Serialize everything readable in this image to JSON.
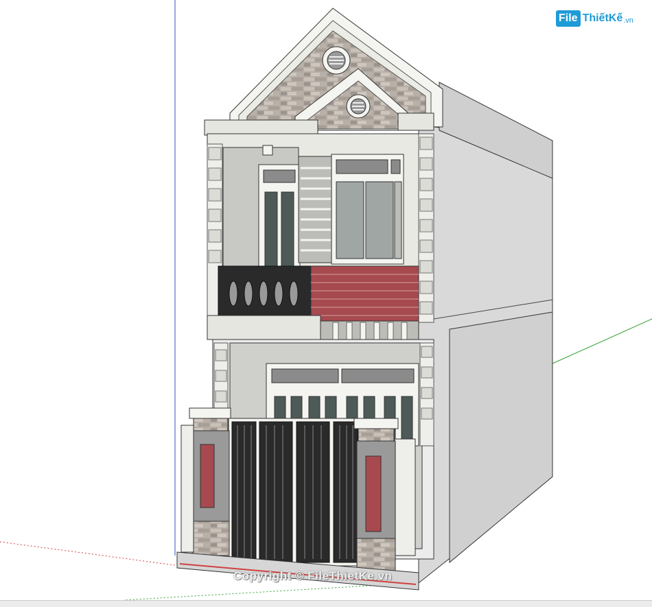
{
  "watermark": {
    "logo_mark": "File",
    "logo_name": "ThiếtKế",
    "logo_tld": ".vn",
    "copyright": "Copyright © FileThietKe.vn"
  },
  "colors": {
    "accent_red": "#a64a4f",
    "brand_blue": "#1f9bd6",
    "wall_light": "#e6e6e0",
    "wall_side": "#d6d6d6",
    "axis_red": "#d04040",
    "axis_green": "#30a030",
    "axis_blue": "#3050d0"
  }
}
